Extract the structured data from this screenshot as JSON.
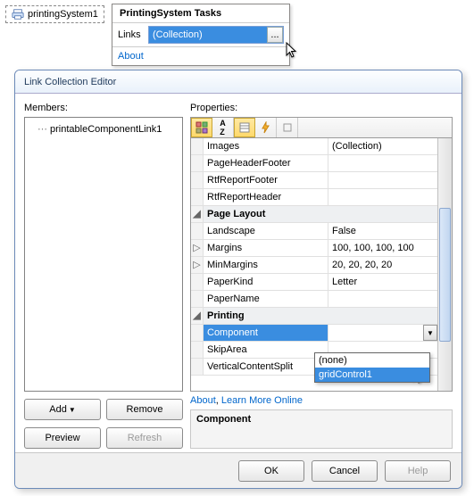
{
  "tag": {
    "label": "printingSystem1"
  },
  "tasks": {
    "title": "PrintingSystem Tasks",
    "links_label": "Links",
    "links_value": "(Collection)",
    "ellipsis": "...",
    "about_label": "About"
  },
  "dialog": {
    "title": "Link Collection Editor",
    "members_label": "Members:",
    "member0": "printableComponentLink1",
    "add_label": "Add",
    "remove_label": "Remove",
    "preview_label": "Preview",
    "refresh_label": "Refresh",
    "properties_label": "Properties:",
    "grid": {
      "images_name": "Images",
      "images_val": "(Collection)",
      "phf_name": "PageHeaderFooter",
      "rrf_name": "RtfReportFooter",
      "rrh_name": "RtfReportHeader",
      "cat_pagelayout": "Page Layout",
      "landscape_name": "Landscape",
      "landscape_val": "False",
      "margins_name": "Margins",
      "margins_val": "100, 100, 100, 100",
      "minmargins_name": "MinMargins",
      "minmargins_val": "20, 20, 20, 20",
      "paperkind_name": "PaperKind",
      "paperkind_val": "Letter",
      "papername_name": "PaperName",
      "cat_printing": "Printing",
      "component_name": "Component",
      "skiparea_name": "SkipArea",
      "vcs_name": "VerticalContentSplit"
    },
    "dropdown": {
      "opt_none": "(none)",
      "opt_grid": "gridControl1"
    },
    "links": {
      "about": "About",
      "learn": "Learn More Online",
      "sep": ", "
    },
    "desc_title": "Component",
    "ok": "OK",
    "cancel": "Cancel",
    "help": "Help"
  }
}
